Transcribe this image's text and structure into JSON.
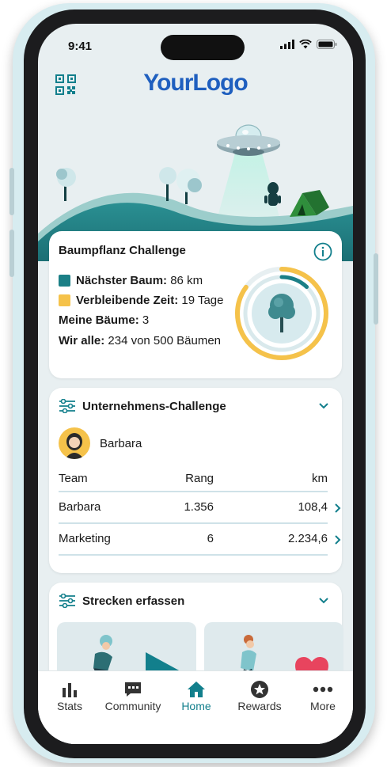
{
  "status_bar": {
    "time": "9:41"
  },
  "header": {
    "logo_text": "YourLogo"
  },
  "challenge_card": {
    "title": "Baumpflanz Challenge",
    "next_tree_label": "Nächster Baum:",
    "next_tree_value": "86 km",
    "remaining_label": "Verbleibende Zeit:",
    "remaining_value": "19 Tage",
    "my_trees_label": "Meine Bäume:",
    "my_trees_value": "3",
    "all_label": "Wir alle:",
    "all_value": "234 von 500 Bäumen",
    "next_tree_progress": 0.12,
    "remaining_time_progress": 0.85
  },
  "company_card": {
    "title": "Unternehmens-Challenge",
    "user_name": "Barbara",
    "columns": [
      "Team",
      "Rang",
      "km"
    ],
    "rows": [
      {
        "team": "Barbara",
        "rank": "1.356",
        "km": "108,4"
      },
      {
        "team": "Marketing",
        "rank": "6",
        "km": "2.234,6"
      }
    ]
  },
  "tracks_card": {
    "title": "Strecken erfassen"
  },
  "tabbar": {
    "items": [
      {
        "label": "Stats",
        "icon": "bar-chart-icon"
      },
      {
        "label": "Community",
        "icon": "chat-icon"
      },
      {
        "label": "Home",
        "icon": "home-icon"
      },
      {
        "label": "Rewards",
        "icon": "star-badge-icon"
      },
      {
        "label": "More",
        "icon": "more-dots-icon"
      }
    ],
    "active": "Home"
  },
  "colors": {
    "accent": "#127f8c",
    "teal": "#1b7f86",
    "yellow": "#f5c24a",
    "logo_blue": "#1f5fbf"
  }
}
